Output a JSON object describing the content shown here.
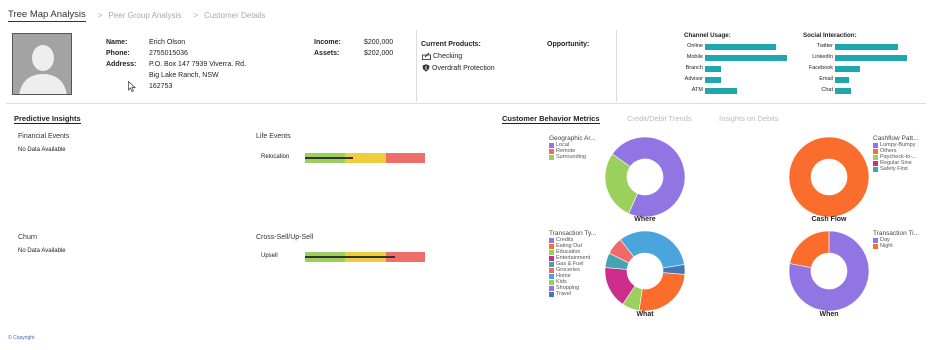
{
  "nav": {
    "active": "Tree Map Analysis",
    "crumbs": [
      "Peer Group Analysis",
      "Customer Details"
    ],
    "separator": ">"
  },
  "customer": {
    "name_label": "Name:",
    "name": "Erich Olson",
    "phone_label": "Phone:",
    "phone": "2755015036",
    "address_label": "Address:",
    "address_1": "P.O. Box 147 7939 Viverra. Rd.",
    "address_2": "Big Lake Ranch, NSW",
    "address_3": "162753",
    "income_label": "Income:",
    "income": "$200,000",
    "assets_label": "Assets:",
    "assets": "$202,000"
  },
  "products": {
    "title": "Current Products:",
    "items": [
      "Checking",
      "Overdraft Protection"
    ]
  },
  "opportunity": {
    "title": "Opportunity:"
  },
  "channel_usage": {
    "title": "Channel Usage:",
    "items": [
      {
        "label": "Online",
        "value": 0.86
      },
      {
        "label": "Mobile",
        "value": 1.0
      },
      {
        "label": "Branch",
        "value": 0.2
      },
      {
        "label": "Advisor",
        "value": 0.2
      },
      {
        "label": "ATM",
        "value": 0.39
      }
    ]
  },
  "social_interaction": {
    "title": "Social Interaction:",
    "items": [
      {
        "label": "Twitter",
        "value": 0.88
      },
      {
        "label": "LinkedIn",
        "value": 1.0
      },
      {
        "label": "Facebook",
        "value": 0.35
      },
      {
        "label": "Email",
        "value": 0.2
      },
      {
        "label": "Chat",
        "value": 0.22
      }
    ]
  },
  "insights": {
    "title": "Predictive Insights",
    "financial_events": "Financial Events",
    "financial_nodata": "No Data Available",
    "life_events": "Life Events",
    "relocation": "Relocation",
    "churn": "Churn",
    "churn_nodata": "No Data Available",
    "cross_sell": "Cross-Sell/Up-Sell",
    "upsell": "Upsell",
    "relocation_value": 0.4,
    "upsell_value": 0.75
  },
  "behavior_tabs": {
    "active": "Customer Behavior Metrics",
    "others": [
      "Credit/Debit Trends",
      "Insights on Debits"
    ]
  },
  "colors": {
    "teal": "#1ea7ad",
    "purple": "#9176e3",
    "orange": "#fb6d2c",
    "green": "#9bd05d",
    "magenta": "#cc2c8a",
    "light_teal": "#45a4b0",
    "salmon": "#ef6a66",
    "blue_light": "#4aa5dc",
    "steel_blue": "#4477b8",
    "bullet_green": "#9bd05d",
    "bullet_yellow": "#f0cd3a",
    "bullet_red": "#ef6e6a"
  },
  "chart_data": [
    {
      "type": "pie",
      "title": "Geographic Ar...",
      "caption": "Where",
      "legend": [
        "Local",
        "Remote",
        "Surrounding"
      ],
      "values": [
        0,
        0.72,
        0.28
      ]
    },
    {
      "type": "pie",
      "title": "Cashflow Patt...",
      "caption": "Cash Flow",
      "legend": [
        "Lumpy-Bumpy",
        "Others",
        "Paycheck-to-...",
        "Regular Sine",
        "Safety First"
      ],
      "values": [
        0,
        1.0,
        0,
        0,
        0
      ]
    },
    {
      "type": "pie",
      "title": "Transaction Ty...",
      "caption": "What",
      "legend": [
        "Credits",
        "Eating Out",
        "Education",
        "Entertainment",
        "Gas & Fuel",
        "Groceries",
        "Home",
        "Kids",
        "Shopping",
        "Travel"
      ],
      "values": [
        0,
        0.26,
        0.07,
        0.17,
        0.06,
        0.07,
        0,
        0,
        0.33,
        0.04
      ]
    },
    {
      "type": "pie",
      "title": "Transaction Ti...",
      "caption": "When",
      "legend": [
        "Day",
        "Night"
      ],
      "values": [
        0.78,
        0.22
      ]
    }
  ],
  "footer": {
    "copyright": "© Copyright"
  }
}
